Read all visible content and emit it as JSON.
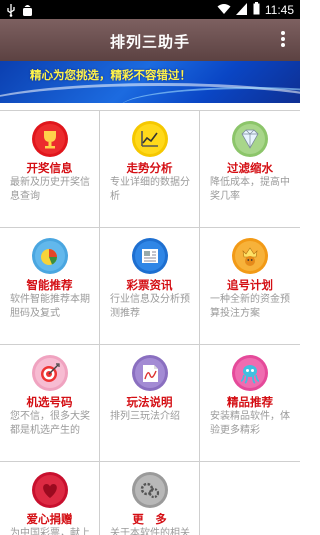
{
  "status_bar": {
    "left_icons": [
      "usb-icon",
      "android-debug-icon"
    ],
    "right_icons": [
      "wifi-icon",
      "signal-icon",
      "battery-icon"
    ],
    "time": "11:45"
  },
  "app_bar": {
    "title": "排列三助手",
    "menu_icon": "overflow-menu-icon"
  },
  "banner": {
    "text": "精心为您挑选，精彩不容错过！"
  },
  "grid": {
    "items": [
      {
        "label": "开奖信息",
        "desc": "最新及历史开奖信息查询",
        "icon": "trophy-icon",
        "color": "#e0161c"
      },
      {
        "label": "走势分析",
        "desc": "专业详细的数据分析",
        "icon": "trend-chart-icon",
        "color": "#f5c800"
      },
      {
        "label": "过滤缩水",
        "desc": "降低成本，提高中奖几率",
        "icon": "diamond-filter-icon",
        "color": "#8cc56a"
      },
      {
        "label": "智能推荐",
        "desc": "软件智能推荐本期胆码及复式",
        "icon": "pie-chart-icon",
        "color": "#4aa6e0"
      },
      {
        "label": "彩票资讯",
        "desc": "行业信息及分析预测推荐",
        "icon": "newspaper-icon",
        "color": "#1e6fd0"
      },
      {
        "label": "追号计划",
        "desc": "一种全新的资金预算投注方案",
        "icon": "crown-lion-icon",
        "color": "#f29a16"
      },
      {
        "label": "机选号码",
        "desc": "您不信，很多大奖都是机选产生的",
        "icon": "target-icon",
        "color": "#f0a3c0"
      },
      {
        "label": "玩法说明",
        "desc": "排列三玩法介绍",
        "icon": "document-icon",
        "color": "#8a6fc0"
      },
      {
        "label": "精品推荐",
        "desc": "安装精品软件，体验更多精彩",
        "icon": "octopus-icon",
        "color": "#e54a9a"
      },
      {
        "label": "爱心捐赠",
        "desc": "为中国彩票，献上一份爱心",
        "icon": "heart-icon",
        "color": "#c8102e"
      },
      {
        "label": "更　多",
        "desc": "关于本软件的相关信息",
        "icon": "more-gear-icon",
        "color": "#9a9a9a"
      }
    ]
  }
}
